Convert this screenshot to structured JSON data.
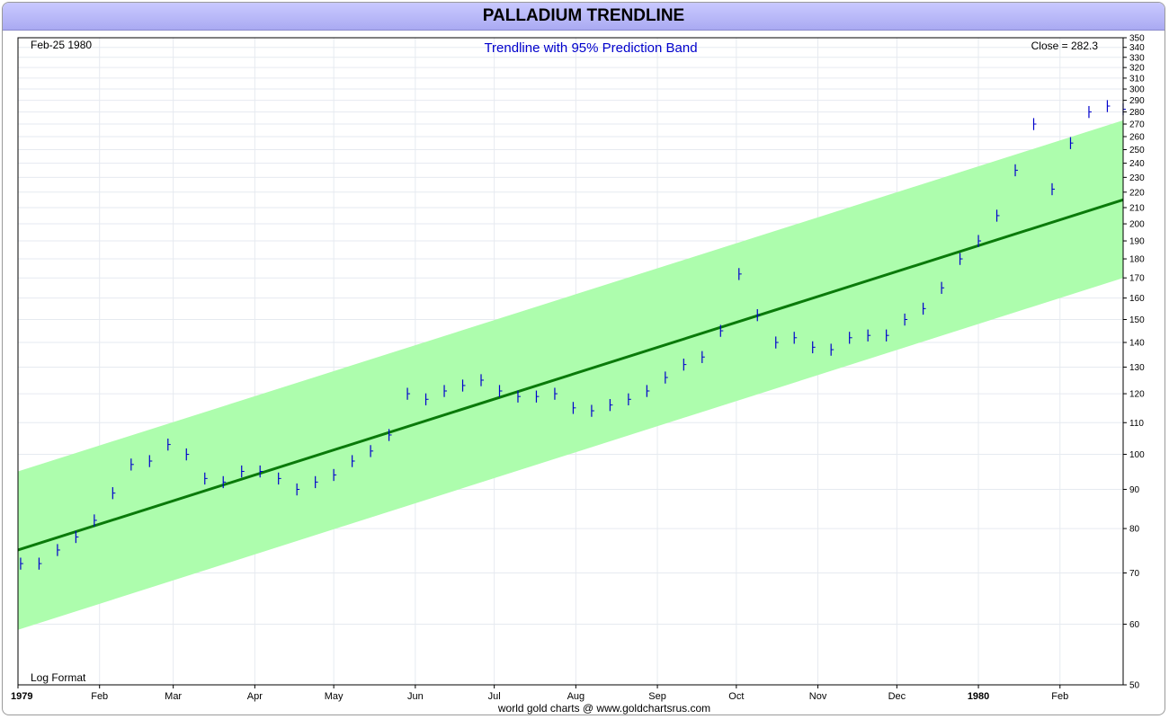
{
  "title": "PALLADIUM TRENDLINE",
  "footer": "world gold charts @ www.goldchartsrus.com",
  "colors": {
    "band": "#adfdad",
    "trend": "#0a7a0a",
    "price": "#0000cc",
    "grid": "#e6eaf0",
    "subtitle": "#0000cc"
  },
  "chart_data": {
    "type": "bar",
    "title": "Trendline with 95% Prediction Band",
    "date_label": "Feb-25  1980",
    "close_label": "Close = 282.3",
    "scale_label": "Log Format",
    "y_scale": "log",
    "ylim": [
      50,
      350
    ],
    "y_ticks": [
      50,
      60,
      70,
      80,
      90,
      100,
      110,
      120,
      130,
      140,
      150,
      160,
      170,
      180,
      190,
      200,
      210,
      220,
      230,
      240,
      250,
      260,
      270,
      280,
      290,
      300,
      310,
      320,
      330,
      340,
      350
    ],
    "x_range": [
      "1979-01-01",
      "1980-02-25"
    ],
    "x_ticks": [
      {
        "date": "1979-01-01",
        "label": "1979",
        "bold": true
      },
      {
        "date": "1979-02-01",
        "label": "Feb"
      },
      {
        "date": "1979-03-01",
        "label": "Mar"
      },
      {
        "date": "1979-04-01",
        "label": "Apr"
      },
      {
        "date": "1979-05-01",
        "label": "May"
      },
      {
        "date": "1979-06-01",
        "label": "Jun"
      },
      {
        "date": "1979-07-01",
        "label": "Jul"
      },
      {
        "date": "1979-08-01",
        "label": "Aug"
      },
      {
        "date": "1979-09-01",
        "label": "Sep"
      },
      {
        "date": "1979-10-01",
        "label": "Oct"
      },
      {
        "date": "1979-11-01",
        "label": "Nov"
      },
      {
        "date": "1979-12-01",
        "label": "Dec"
      },
      {
        "date": "1980-01-01",
        "label": "1980",
        "bold": true
      },
      {
        "date": "1980-02-01",
        "label": "Feb"
      }
    ],
    "trendline": {
      "start": [
        "1979-01-01",
        75
      ],
      "end": [
        "1980-02-25",
        215
      ]
    },
    "band": {
      "upper_start": [
        "1979-01-01",
        95
      ],
      "upper_end": [
        "1980-02-25",
        273
      ],
      "lower_start": [
        "1979-01-01",
        59
      ],
      "lower_end": [
        "1980-02-25",
        170
      ]
    },
    "series": [
      {
        "values": [
          [
            "1979-01-02",
            72
          ],
          [
            "1979-01-09",
            72
          ],
          [
            "1979-01-16",
            75
          ],
          [
            "1979-01-23",
            78
          ],
          [
            "1979-01-30",
            82
          ],
          [
            "1979-02-06",
            89
          ],
          [
            "1979-02-13",
            97
          ],
          [
            "1979-02-20",
            98
          ],
          [
            "1979-02-27",
            103
          ],
          [
            "1979-03-06",
            100
          ],
          [
            "1979-03-13",
            93
          ],
          [
            "1979-03-20",
            92
          ],
          [
            "1979-03-27",
            95
          ],
          [
            "1979-04-03",
            95
          ],
          [
            "1979-04-10",
            93
          ],
          [
            "1979-04-17",
            90
          ],
          [
            "1979-04-24",
            92
          ],
          [
            "1979-05-01",
            94
          ],
          [
            "1979-05-08",
            98
          ],
          [
            "1979-05-15",
            101
          ],
          [
            "1979-05-22",
            106
          ],
          [
            "1979-05-29",
            120
          ],
          [
            "1979-06-05",
            118
          ],
          [
            "1979-06-12",
            121
          ],
          [
            "1979-06-19",
            123
          ],
          [
            "1979-06-26",
            125
          ],
          [
            "1979-07-03",
            121
          ],
          [
            "1979-07-10",
            119
          ],
          [
            "1979-07-17",
            119
          ],
          [
            "1979-07-24",
            120
          ],
          [
            "1979-07-31",
            115
          ],
          [
            "1979-08-07",
            114
          ],
          [
            "1979-08-14",
            116
          ],
          [
            "1979-08-21",
            118
          ],
          [
            "1979-08-28",
            121
          ],
          [
            "1979-09-04",
            126
          ],
          [
            "1979-09-11",
            131
          ],
          [
            "1979-09-18",
            134
          ],
          [
            "1979-09-25",
            145
          ],
          [
            "1979-10-02",
            172
          ],
          [
            "1979-10-09",
            152
          ],
          [
            "1979-10-16",
            140
          ],
          [
            "1979-10-23",
            142
          ],
          [
            "1979-10-30",
            138
          ],
          [
            "1979-11-06",
            137
          ],
          [
            "1979-11-13",
            142
          ],
          [
            "1979-11-20",
            143
          ],
          [
            "1979-11-27",
            143
          ],
          [
            "1979-12-04",
            150
          ],
          [
            "1979-12-11",
            155
          ],
          [
            "1979-12-18",
            165
          ],
          [
            "1979-12-25",
            180
          ],
          [
            "1980-01-01",
            190
          ],
          [
            "1980-01-08",
            205
          ],
          [
            "1980-01-15",
            235
          ],
          [
            "1980-01-22",
            270
          ],
          [
            "1980-01-29",
            222
          ],
          [
            "1980-02-05",
            255
          ],
          [
            "1980-02-12",
            280
          ],
          [
            "1980-02-19",
            285
          ],
          [
            "1980-02-25",
            282.3
          ]
        ]
      }
    ]
  }
}
